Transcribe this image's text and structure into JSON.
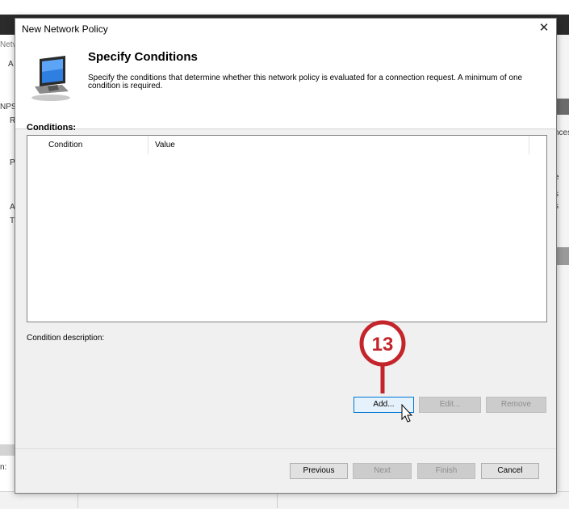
{
  "background_app": {
    "left_fragments": [
      "Netv",
      "A",
      "NPS",
      "R",
      "P",
      "A",
      "T"
    ],
    "right_fragments": [
      "nces",
      "e",
      "s",
      "s"
    ],
    "bottom_fragment": "n:"
  },
  "dialog": {
    "title": "New Network Policy",
    "close_glyph": "✕",
    "header": {
      "title": "Specify Conditions",
      "description": "Specify the conditions that determine whether this network policy is evaluated for a connection request. A minimum of one condition is required."
    },
    "conditions": {
      "label": "Conditions:",
      "columns": [
        "Condition",
        "Value"
      ]
    },
    "condition_description_label": "Condition description:",
    "action_buttons": {
      "add": "Add...",
      "edit": "Edit...",
      "remove": "Remove"
    },
    "footer_buttons": {
      "previous": "Previous",
      "next": "Next",
      "finish": "Finish",
      "cancel": "Cancel"
    }
  },
  "callout": {
    "step_number": "13",
    "color": "#c4252a"
  },
  "colors": {
    "accent": "#0078d7",
    "callout_red": "#c4252a"
  }
}
